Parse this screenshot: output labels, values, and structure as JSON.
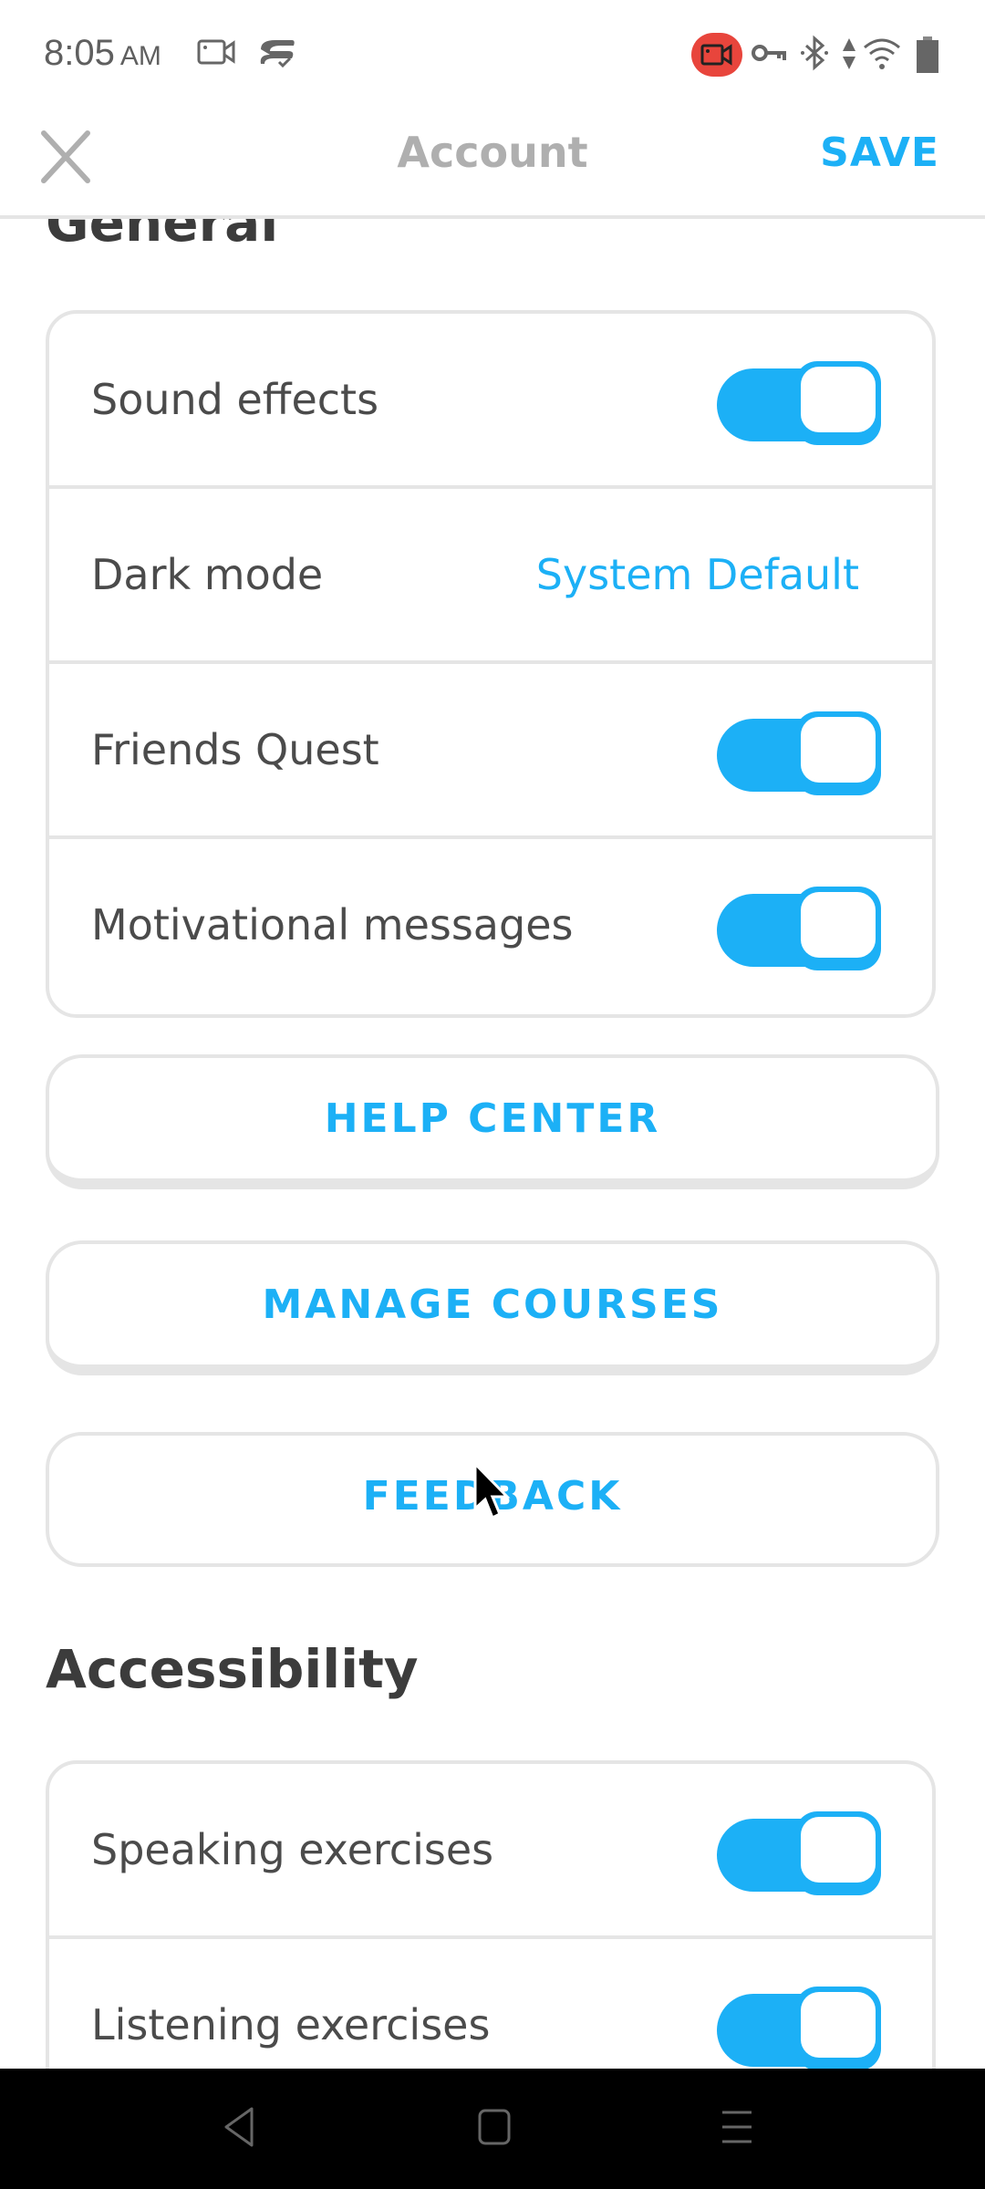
{
  "status_bar": {
    "time": "8:05",
    "ampm": "AM",
    "icons": [
      "screen-record-icon",
      "tethering-icon",
      "recording-active-icon",
      "vpn-key-icon",
      "bluetooth-icon",
      "data-arrows-icon",
      "wifi-icon",
      "battery-icon"
    ],
    "record_color": "#e8453c"
  },
  "header": {
    "title": "Account",
    "save_label": "SAVE",
    "close_icon": "close-icon"
  },
  "sections": {
    "general": {
      "title": "General",
      "rows": [
        {
          "label": "Sound effects",
          "type": "toggle",
          "on": true
        },
        {
          "label": "Dark mode",
          "type": "value",
          "value": "System Default"
        },
        {
          "label": "Friends Quest",
          "type": "toggle",
          "on": true
        },
        {
          "label": "Motivational messages",
          "type": "toggle",
          "on": true
        }
      ]
    },
    "buttons": [
      {
        "label": "HELP CENTER"
      },
      {
        "label": "MANAGE COURSES"
      },
      {
        "label": "FEEDBACK"
      }
    ],
    "accessibility": {
      "title": "Accessibility",
      "rows": [
        {
          "label": "Speaking exercises",
          "type": "toggle",
          "on": true
        },
        {
          "label": "Listening exercises",
          "type": "toggle",
          "on": true
        }
      ]
    }
  },
  "colors": {
    "accent": "#1cb0f6",
    "border": "#e5e5e5",
    "text": "#4b4b4b",
    "heading": "#3c3c3c",
    "title_gray": "#afafaf"
  },
  "nav_bar": {
    "icons": [
      "back-icon",
      "home-icon",
      "recents-icon"
    ]
  }
}
